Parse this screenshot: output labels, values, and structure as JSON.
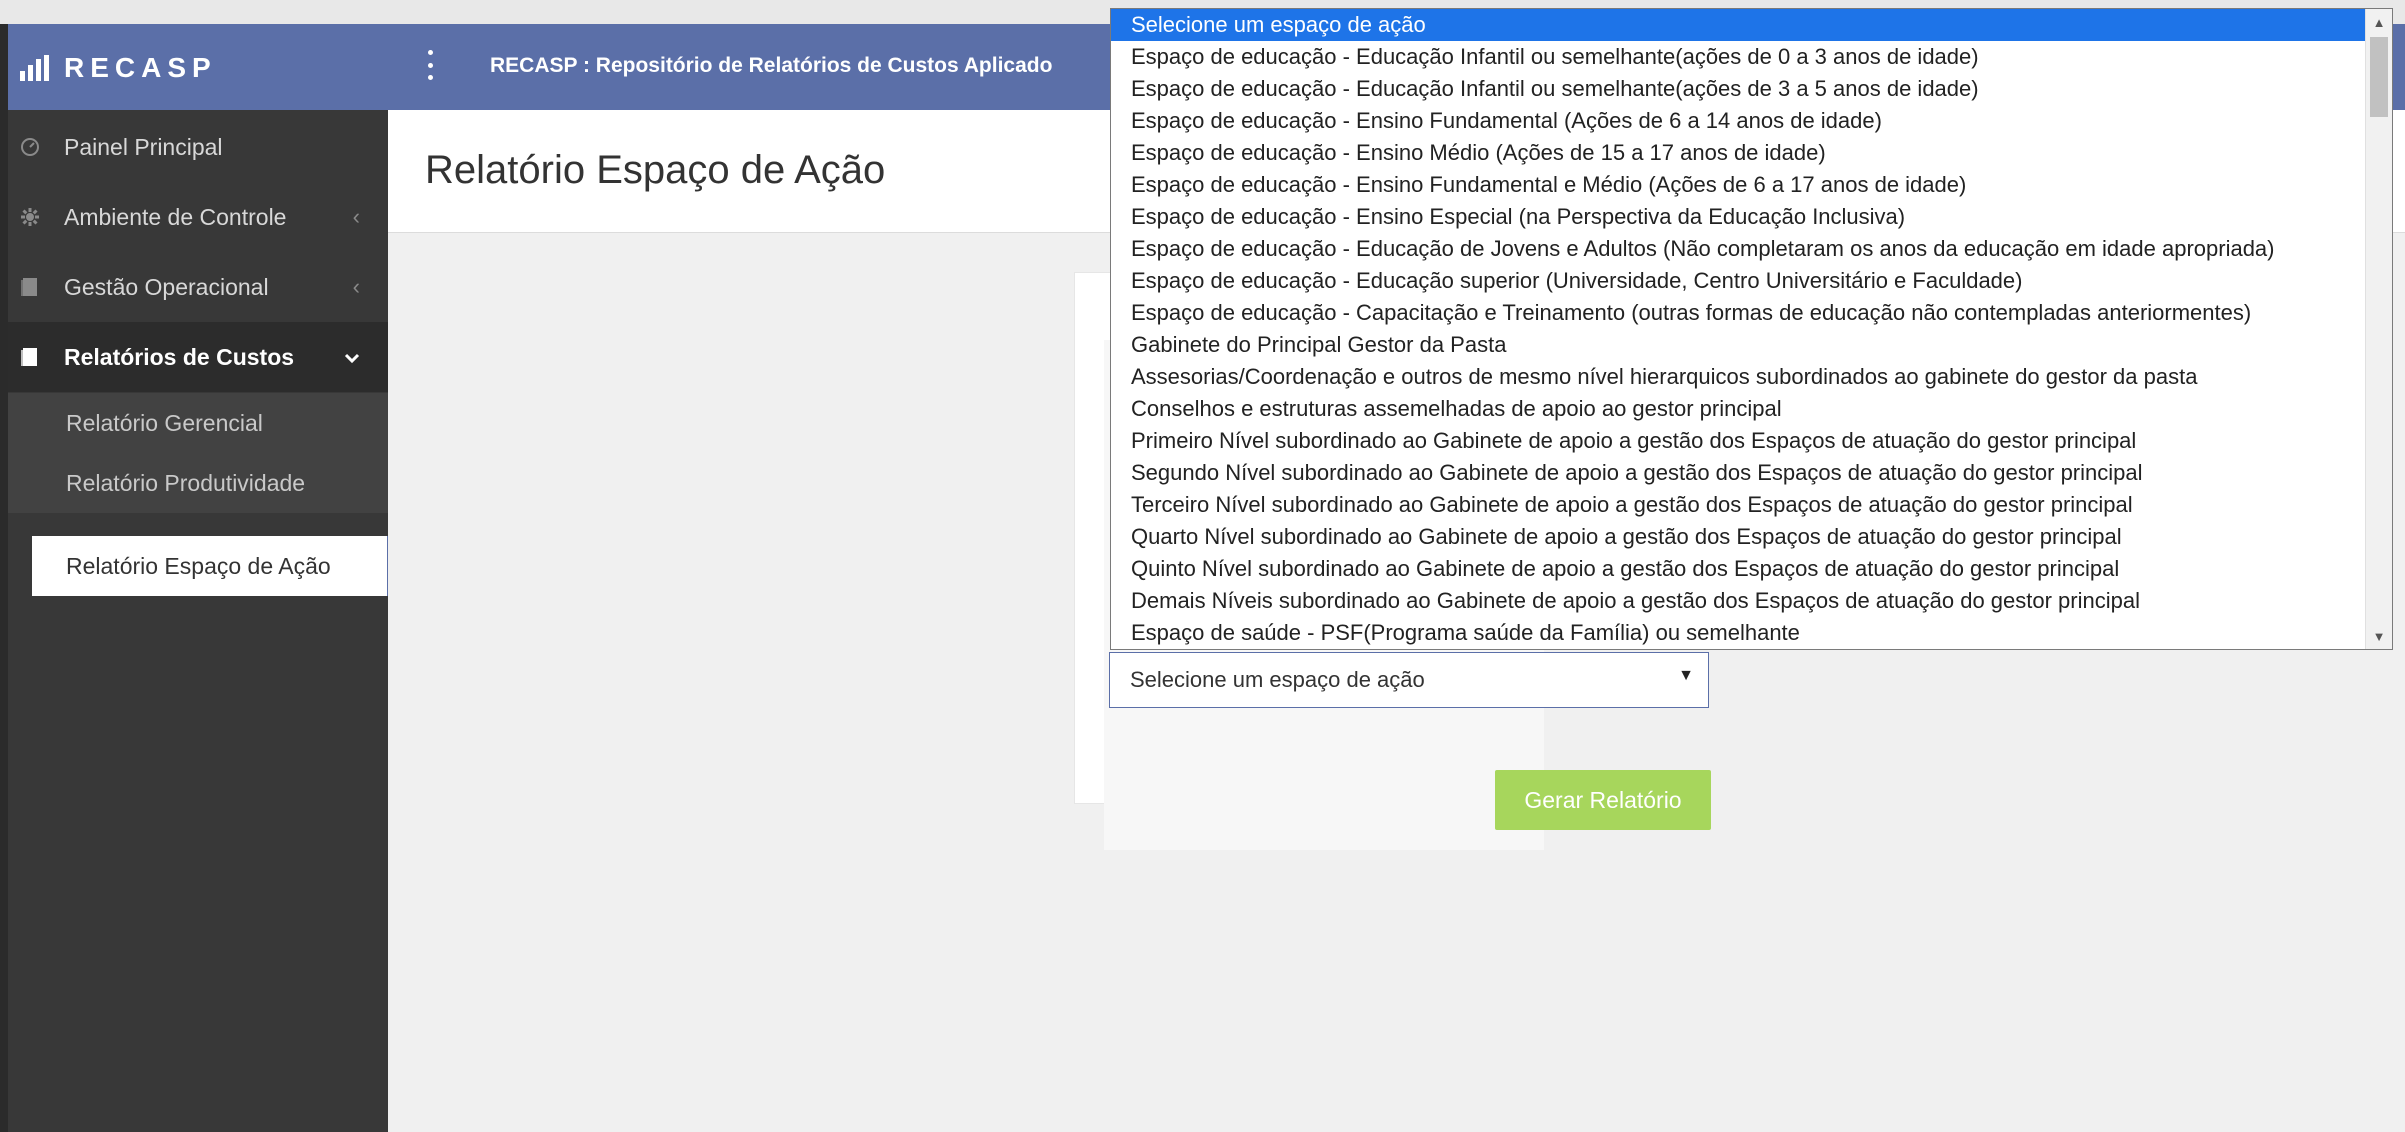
{
  "app": {
    "brand": "RECASP",
    "title": "RECASP : Repositório de Relatórios de Custos Aplicado"
  },
  "sidebar": {
    "items": [
      {
        "label": "Painel Principal",
        "icon": "dashboard-icon"
      },
      {
        "label": "Ambiente de Controle",
        "icon": "gear-icon",
        "chevron": "‹"
      },
      {
        "label": "Gestão Operacional",
        "icon": "book-icon",
        "chevron": "‹"
      },
      {
        "label": "Relatórios de Custos",
        "icon": "document-icon",
        "chevron": "⌄"
      }
    ],
    "subitems": [
      {
        "label": "Relatório Gerencial"
      },
      {
        "label": "Relatório Produtividade"
      },
      {
        "label": "Relatório Espaço de Ação"
      }
    ]
  },
  "page": {
    "title": "Relatório Espaço de Ação"
  },
  "form": {
    "select_value": "Selecione um espaço de ação",
    "submit_label": "Gerar Relatório"
  },
  "dropdown": {
    "options": [
      "Selecione um espaço de ação",
      "Espaço de educação - Educação Infantil ou semelhante(ações de 0 a 3 anos de idade)",
      "Espaço de educação - Educação Infantil ou semelhante(ações de 3 a 5 anos de idade)",
      "Espaço de educação - Ensino Fundamental (Ações de 6 a 14 anos de idade)",
      "Espaço de educação - Ensino Médio (Ações de 15 a 17 anos de idade)",
      "Espaço de educação - Ensino Fundamental e Médio (Ações de 6 a 17 anos de idade)",
      "Espaço de educação - Ensino Especial (na Perspectiva da Educação Inclusiva)",
      "Espaço de educação - Educação de Jovens e Adultos (Não completaram os anos da educação em idade apropriada)",
      "Espaço de educação - Educação superior (Universidade, Centro Universitário e Faculdade)",
      "Espaço de educação - Capacitação e Treinamento (outras formas de educação não contempladas anteriormentes)",
      "Gabinete do Principal Gestor da Pasta",
      "Assesorias/Coordenação e outros de mesmo nível hierarquicos subordinados ao gabinete do gestor da pasta",
      "Conselhos e estruturas assemelhadas de apoio ao gestor principal",
      "Primeiro Nível subordinado ao Gabinete de apoio a gestão dos Espaços de atuação do gestor principal",
      "Segundo Nível subordinado ao Gabinete de apoio a gestão dos Espaços de atuação do gestor principal",
      "Terceiro Nível subordinado ao Gabinete de apoio a gestão dos Espaços de atuação do gestor principal",
      "Quarto Nível subordinado ao Gabinete de apoio a gestão dos Espaços de atuação do gestor principal",
      "Quinto Nível subordinado ao Gabinete de apoio a gestão dos Espaços de atuação do gestor principal",
      "Demais Níveis subordinado ao Gabinete de apoio a gestão dos Espaços de atuação do gestor principal",
      "Espaço de saúde - PSF(Programa saúde da Família) ou semelhante"
    ]
  },
  "colors": {
    "header": "#5b6fa8",
    "sidebar": "#383838",
    "highlight": "#1e74e8",
    "button": "#a7d65c"
  }
}
